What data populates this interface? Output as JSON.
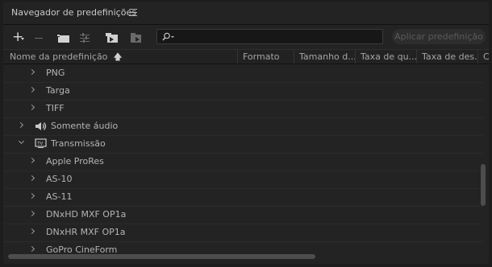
{
  "panel": {
    "title": "Navegador de predefinições",
    "menu_icon": "hamburger-icon"
  },
  "toolbar": {
    "new_icon": "plus-icon",
    "remove_icon": "minus-icon",
    "new_group_icon": "folder-icon",
    "settings_icon": "settings-icon",
    "import_icon": "import-icon",
    "export_icon": "export-icon"
  },
  "search": {
    "value": "",
    "icon": "search-icon"
  },
  "apply_label": "Aplicar predefinição",
  "columns": [
    {
      "label": "Nome da predefinição",
      "sort": "ascending"
    },
    {
      "label": "Formato"
    },
    {
      "label": "Tamanho d..."
    },
    {
      "label": "Taxa de qu..."
    },
    {
      "label": "Taxa de des..."
    },
    {
      "label": "C"
    }
  ],
  "rows": [
    {
      "label": "PNG",
      "level": 2,
      "expanded": false
    },
    {
      "label": "Targa",
      "level": 2,
      "expanded": false
    },
    {
      "label": "TIFF",
      "level": 2,
      "expanded": false
    },
    {
      "label": "Somente áudio",
      "level": 1,
      "expanded": false,
      "icon": "speaker-icon"
    },
    {
      "label": "Transmissão",
      "level": 1,
      "expanded": true,
      "icon": "tv-icon"
    },
    {
      "label": "Apple ProRes",
      "level": 2,
      "expanded": false
    },
    {
      "label": "AS-10",
      "level": 2,
      "expanded": false
    },
    {
      "label": "AS-11",
      "level": 2,
      "expanded": false
    },
    {
      "label": "DNxHD MXF OP1a",
      "level": 2,
      "expanded": false
    },
    {
      "label": "DNxHR MXF OP1a",
      "level": 2,
      "expanded": false
    },
    {
      "label": "GoPro CineForm",
      "level": 2,
      "expanded": false
    }
  ]
}
